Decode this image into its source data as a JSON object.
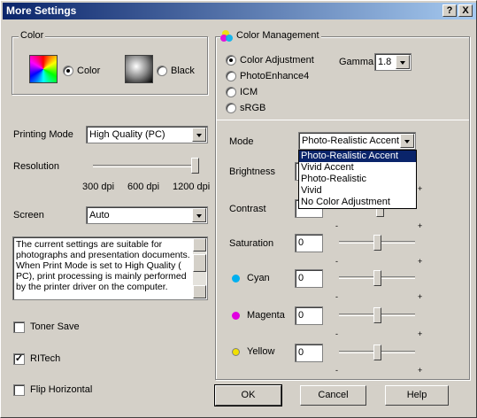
{
  "window": {
    "title": "More Settings",
    "help_btn": "?",
    "close_btn": "X"
  },
  "color_group": {
    "label": "Color",
    "color_option": "Color",
    "black_option": "Black",
    "selected": "Color"
  },
  "printing_mode": {
    "label": "Printing Mode",
    "value": "High Quality (PC)"
  },
  "resolution": {
    "label": "Resolution",
    "ticks": [
      "300 dpi",
      "600 dpi",
      "1200 dpi"
    ],
    "value": "1200 dpi"
  },
  "screen": {
    "label": "Screen",
    "value": "Auto"
  },
  "description": "The current settings are suitable for photographs and presentation documents. When Print Mode is set to High Quality ( PC), print processing is mainly performed by the printer driver on the computer.",
  "toner_save": {
    "label": "Toner Save",
    "checked": false
  },
  "ritech": {
    "label": "RITech",
    "checked": true,
    "mark": "✓"
  },
  "flip_horizontal": {
    "label": "Flip Horizontal",
    "checked": false
  },
  "color_management": {
    "label": "Color Management",
    "options": [
      "Color Adjustment",
      "PhotoEnhance4",
      "ICM",
      "sRGB"
    ],
    "selected": "Color Adjustment",
    "gamma_label": "Gamma",
    "gamma_value": "1.8"
  },
  "mode": {
    "label": "Mode",
    "value": "Photo-Realistic Accent",
    "options": [
      "Photo-Realistic Accent",
      "Vivid Accent",
      "Photo-Realistic",
      "Vivid",
      "No Color Adjustment"
    ]
  },
  "adjustments": {
    "brightness": {
      "label": "Brightness"
    },
    "contrast": {
      "label": "Contrast"
    },
    "saturation": {
      "label": "Saturation",
      "value": "0"
    },
    "cyan": {
      "label": "Cyan",
      "value": "0"
    },
    "magenta": {
      "label": "Magenta",
      "value": "0"
    },
    "yellow": {
      "label": "Yellow",
      "value": "0"
    },
    "minus": "-",
    "plus": "+"
  },
  "buttons": {
    "ok": "OK",
    "cancel": "Cancel",
    "help": "Help"
  },
  "colors": {
    "titlebar": "#0a246a",
    "face": "#d4d0c8",
    "highlight": "#0a246a",
    "cyan": "#00b0f0",
    "magenta": "#e000e0",
    "yellow": "#f0e000"
  }
}
